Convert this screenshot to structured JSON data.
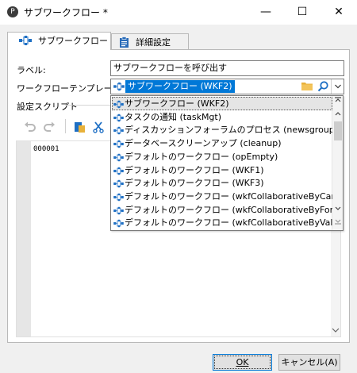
{
  "window": {
    "title": "サブワークフロー *",
    "app_icon_glyph": "P",
    "minimize_glyph": "—",
    "maximize_glyph": "☐",
    "close_glyph": "✕"
  },
  "tabs": [
    {
      "label": "サブワークフロー",
      "icon": "workflow-icon",
      "active": true
    },
    {
      "label": "詳細設定",
      "icon": "clipboard-icon",
      "active": false
    }
  ],
  "form": {
    "label_caption": "ラベル:",
    "label_value": "サブワークフローを呼び出す",
    "template_caption": "ワークフローテンプレート:",
    "template_value": "サブワークフロー (WKF2)",
    "script_caption": "設定スクリプト"
  },
  "toolbar": {
    "undo_icon": "undo-icon",
    "redo_icon": "redo-icon",
    "paste_icon": "paste-icon",
    "cut_icon": "cut-icon"
  },
  "editor": {
    "line_number": "000001"
  },
  "dropdown": {
    "items": [
      {
        "text": "サブワークフロー (WKF2)",
        "selected": true
      },
      {
        "text": "タスクの通知 (taskMgt)",
        "selected": false
      },
      {
        "text": "ディスカッションフォーラムのプロセス (newsgroupMgt)",
        "selected": false
      },
      {
        "text": "データベースクリーンアップ (cleanup)",
        "selected": false
      },
      {
        "text": "デフォルトのワークフロー (opEmpty)",
        "selected": false
      },
      {
        "text": "デフォルトのワークフロー (WKF1)",
        "selected": false
      },
      {
        "text": "デフォルトのワークフロー (WKF3)",
        "selected": false
      },
      {
        "text": "デフォルトのワークフロー (wkfCollaborativeByCamp..",
        "selected": false
      },
      {
        "text": "デフォルトのワークフロー (wkfCollaborativeByForm)",
        "selected": false
      },
      {
        "text": "デフォルトのワークフロー (wkfCollaborativeByValida..",
        "selected": false
      }
    ]
  },
  "buttons": {
    "ok_label": "OK",
    "cancel_label": "キャンセル(A)"
  },
  "colors": {
    "accent": "#0078d7",
    "workflow_icon_blue": "#1e6fc4",
    "folder_yellow": "#e8b13a"
  }
}
